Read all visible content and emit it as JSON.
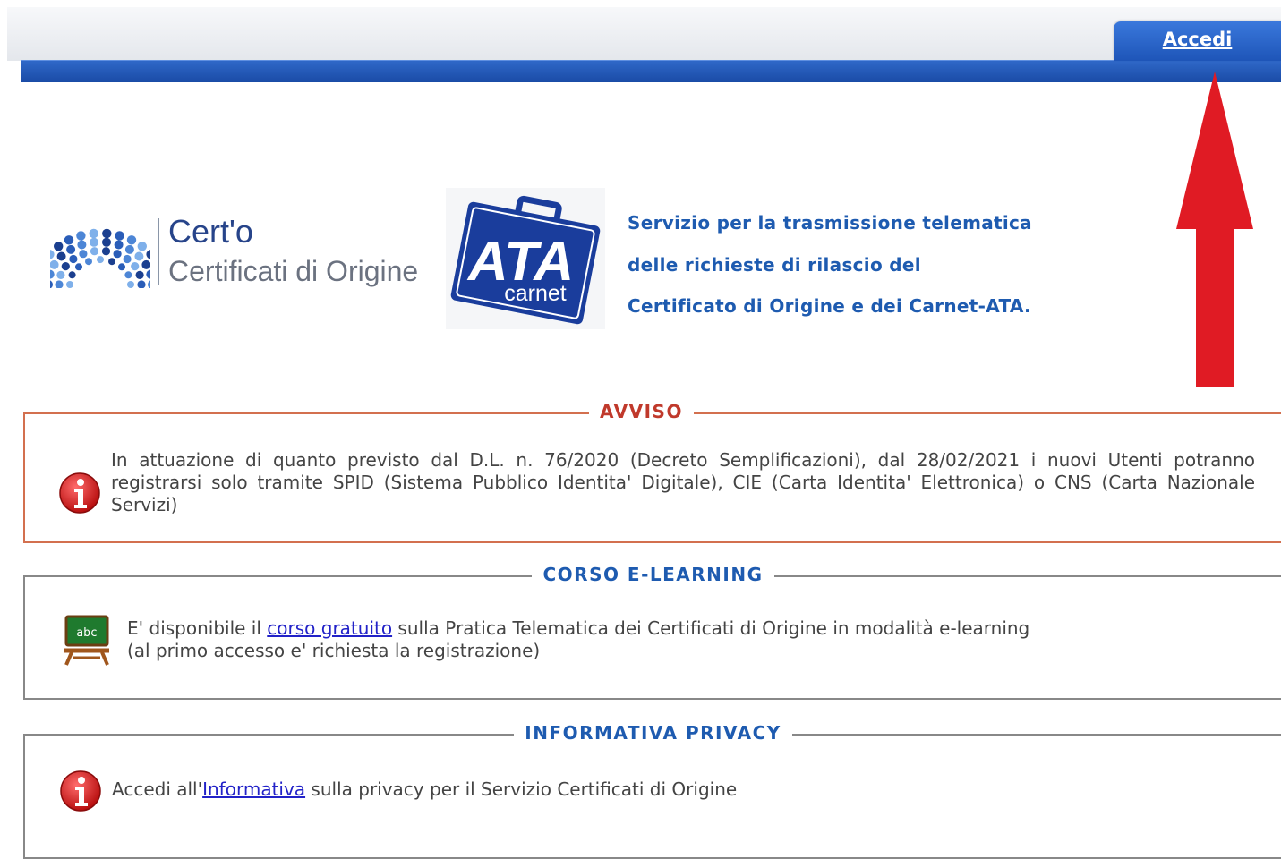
{
  "header": {
    "login_label": "Accedi"
  },
  "branding": {
    "certo_name": "Cert'o",
    "certo_subtitle": "Certificati di Origine",
    "ata_title": "ATA",
    "ata_subtitle": "carnet",
    "service_lines": [
      "Servizio per la trasmissione telematica",
      "delle richieste di rilascio del",
      "Certificato di Origine e dei Carnet-ATA."
    ]
  },
  "avviso": {
    "title": "AVVISO",
    "text": "In attuazione di quanto previsto dal D.L. n. 76/2020 (Decreto Semplificazioni), dal 28/02/2021 i nuovi Utenti potranno registrarsi solo tramite SPID (Sistema Pubblico Identita' Digitale), CIE (Carta Identita' Elettronica) o CNS (Carta Nazionale Servizi)"
  },
  "elearning": {
    "title": "CORSO E-LEARNING",
    "text_before": "E' disponibile il ",
    "link_label": "corso gratuito",
    "text_after": " sulla Pratica Telematica dei Certificati di Origine in modalità e-learning",
    "text_line2": "(al primo accesso e' richiesta la registrazione)",
    "board_letters": "abc"
  },
  "privacy": {
    "title": "INFORMATIVA PRIVACY",
    "text_before": "Accedi all'",
    "link_label": "Informativa",
    "text_after": " sulla privacy per il Servizio Certificati di Origine"
  },
  "colors": {
    "brand_blue": "#1e5bb0",
    "header_blue": "#1a4ba6",
    "alert_red": "#c0392b",
    "annotation_arrow": "#e01b24",
    "link": "#2222c8"
  }
}
